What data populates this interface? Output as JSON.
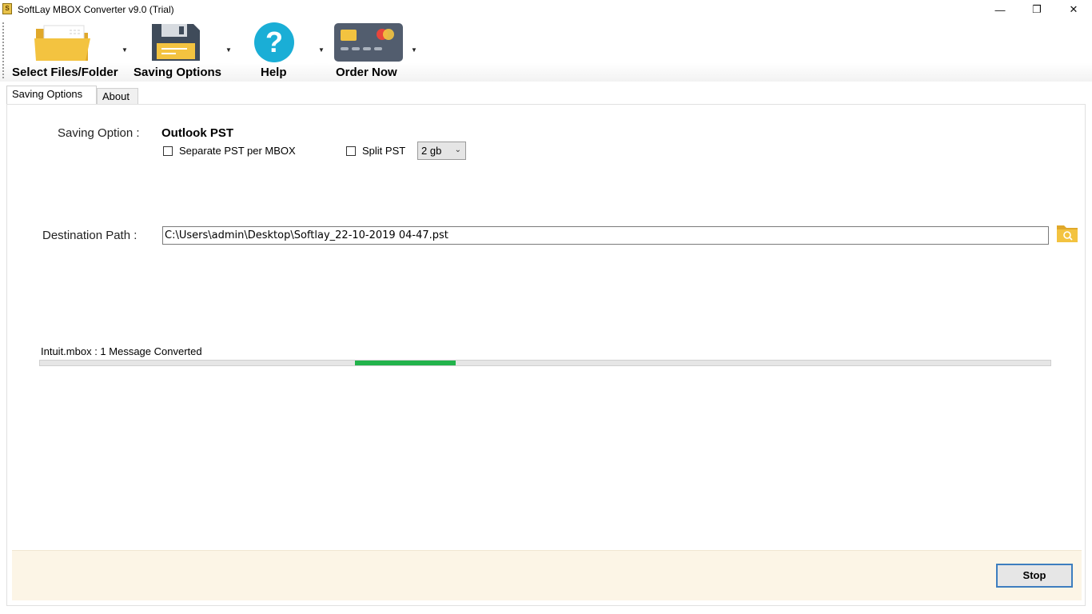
{
  "window": {
    "title": "SoftLay MBOX Converter v9.0 (Trial)",
    "app_icon_glyph": "S",
    "minimize": "—",
    "maximize": "❐",
    "close": "✕"
  },
  "toolbar": {
    "items": [
      {
        "label": "Select Files/Folder",
        "icon": "folder-icon"
      },
      {
        "label": "Saving Options",
        "icon": "floppy-disk-icon"
      },
      {
        "label": "Help",
        "icon": "help-icon"
      },
      {
        "label": "Order Now",
        "icon": "credit-card-icon"
      }
    ],
    "dropdown_arrow": "▼"
  },
  "tabs": [
    {
      "label": "Saving Options",
      "active": true
    },
    {
      "label": "About",
      "active": false
    }
  ],
  "form": {
    "saving_option_label": "Saving Option :",
    "saving_option_value": "Outlook PST",
    "separate_pst_label": "Separate PST per MBOX",
    "separate_pst_checked": false,
    "split_pst_label": "Split PST",
    "split_pst_checked": false,
    "split_size_value": "2 gb",
    "destination_label": "Destination Path :",
    "destination_value": "C:\\Users\\admin\\Desktop\\Softlay_22-10-2019 04-47.pst"
  },
  "progress": {
    "status_text": "Intuit.mbox : 1 Message Converted",
    "fill_start_fraction": 0.312,
    "fill_width_fraction": 0.1,
    "color": "#22b34b"
  },
  "footer": {
    "stop_label": "Stop"
  },
  "colors": {
    "footer_bg": "#fcf5e6",
    "help_blue": "#1aaed6",
    "folder_yellow": "#f3c340",
    "stop_border": "#3d7ebf"
  }
}
